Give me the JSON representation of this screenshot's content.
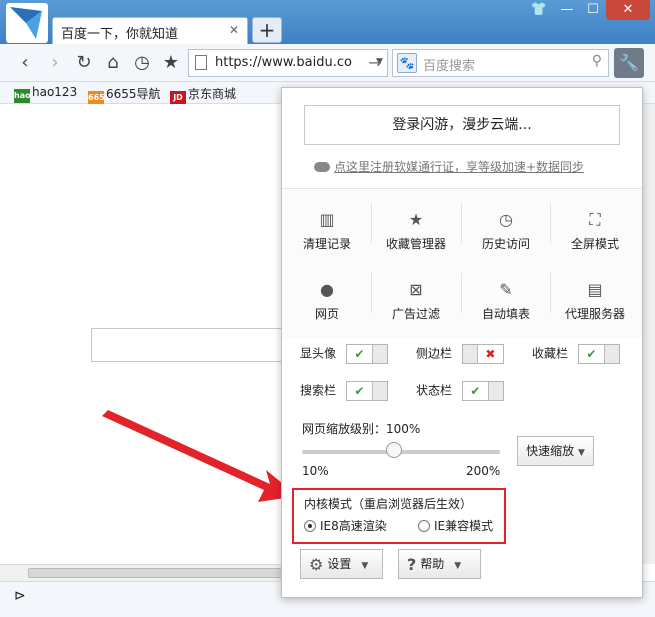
{
  "tab": {
    "title": "百度一下，你就知道",
    "close": "✕"
  },
  "window": {
    "new_tab": "+",
    "minimize": "—",
    "maximize": "☐",
    "close": "✕",
    "skin": "👕"
  },
  "toolbar": {
    "back": "‹",
    "forward": "›",
    "refresh": "↻",
    "home": "⌂",
    "history": "◷",
    "favorite": "★",
    "address": "https://www.baidu.co",
    "search_placeholder": "百度搜索",
    "search_engine_icon": "paw-icon",
    "settings_icon": "wrench-icon"
  },
  "bookmarks": [
    {
      "label": "hao123",
      "icon_text": "hao",
      "color": "#2f8a2f"
    },
    {
      "label": "6655导航",
      "icon_text": "6655",
      "color": "#f08a1c"
    },
    {
      "label": "京东商城",
      "icon_text": "JD",
      "color": "#c8161d"
    }
  ],
  "panel": {
    "login_button": "登录闪游，漫步云端...",
    "register_link": "点这里注册软媒通行证，享等级加速+数据同步",
    "grid": [
      {
        "label": "清理记录",
        "icon": "broom-icon",
        "glyph": "▥"
      },
      {
        "label": "收藏管理器",
        "icon": "star-folder-icon",
        "glyph": "★"
      },
      {
        "label": "历史访问",
        "icon": "clock-icon",
        "glyph": "◷"
      },
      {
        "label": "全屏模式",
        "icon": "fullscreen-icon",
        "glyph": "⛶"
      },
      {
        "label": "网页",
        "icon": "globe-icon",
        "glyph": "●"
      },
      {
        "label": "广告过滤",
        "icon": "ad-filter-icon",
        "glyph": "⊠"
      },
      {
        "label": "自动填表",
        "icon": "edit-icon",
        "glyph": "✎"
      },
      {
        "label": "代理服务器",
        "icon": "proxy-icon",
        "glyph": "▤"
      }
    ],
    "toggles": [
      {
        "label": "显头像",
        "on": true
      },
      {
        "label": "侧边栏",
        "on": false
      },
      {
        "label": "收藏栏",
        "on": true
      },
      {
        "label": "搜索栏",
        "on": true
      },
      {
        "label": "状态栏",
        "on": true
      }
    ],
    "zoom": {
      "label": "网页缩放级别：100%",
      "min": "10%",
      "max": "200%",
      "level": 100,
      "quick_zoom": "快速缩放"
    },
    "kernel": {
      "title": "内核模式（重启浏览器后生效）",
      "option1": "IE8高速渲染",
      "option2": "IE兼容模式",
      "selected": "IE8高速渲染"
    },
    "settings_button": "设置",
    "help_button": "帮助"
  },
  "colors": {
    "highlight_border": "#e2232a",
    "arrow": "#e2232a",
    "titlebar": "#4a8fd0"
  }
}
